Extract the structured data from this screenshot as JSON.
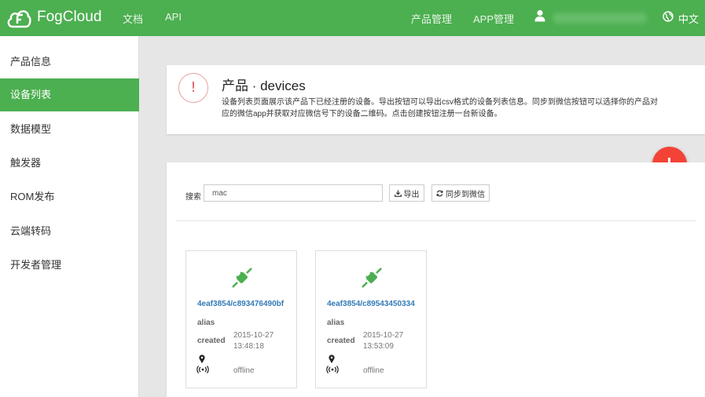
{
  "header": {
    "brand": "FogCloud",
    "nav_docs": "文档",
    "nav_api": "API",
    "nav_products": "产品管理",
    "nav_apps": "APP管理",
    "language": "中文",
    "colors": {
      "primary": "#4caf50",
      "danger": "#f44336",
      "link": "#337ab7"
    }
  },
  "sidebar": {
    "items": [
      {
        "label": "产品信息",
        "active": false
      },
      {
        "label": "设备列表",
        "active": true
      },
      {
        "label": "数据模型",
        "active": false
      },
      {
        "label": "触发器",
        "active": false
      },
      {
        "label": "ROM发布",
        "active": false
      },
      {
        "label": "云端转码",
        "active": false
      },
      {
        "label": "开发者管理",
        "active": false
      }
    ]
  },
  "info": {
    "title": "产品 · devices",
    "description": "设备列表页面展示该产品下已经注册的设备。导出按钮可以导出csv格式的设备列表信息。同步到微信按钮可以选择你的产品对应的微信app并获取对应微信号下的设备二维码。点击创建按钮注册一台新设备。"
  },
  "toolbar": {
    "search_label": "搜索",
    "search_value": "mac",
    "export_label": "导出",
    "sync_label": "同步到微信"
  },
  "devices": [
    {
      "id": "4eaf3854/c893476490bf",
      "alias_label": "alias",
      "created_label": "created",
      "created_date": "2015-10-27",
      "created_time": "13:48:18",
      "status": "offline"
    },
    {
      "id": "4eaf3854/c89543450334",
      "alias_label": "alias",
      "created_label": "created",
      "created_date": "2015-10-27",
      "created_time": "13:53:09",
      "status": "offline"
    }
  ]
}
